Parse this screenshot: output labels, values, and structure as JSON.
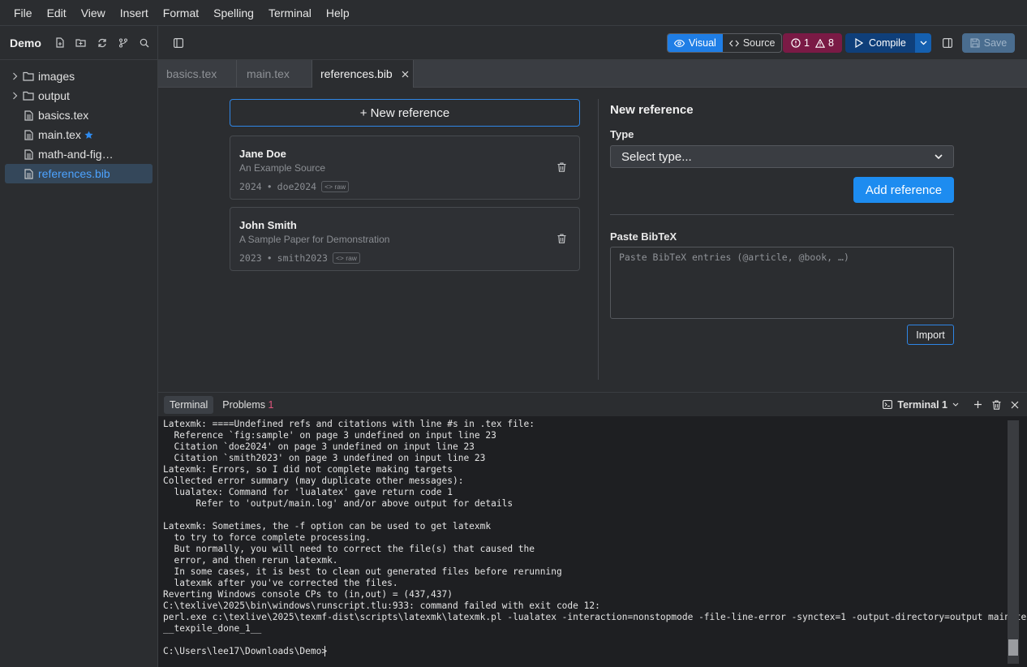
{
  "menu": [
    "File",
    "Edit",
    "View",
    "Insert",
    "Format",
    "Spelling",
    "Terminal",
    "Help"
  ],
  "sidebar": {
    "project_name": "Demo",
    "items": [
      {
        "label": "images",
        "type": "folder"
      },
      {
        "label": "output",
        "type": "folder"
      },
      {
        "label": "basics.tex",
        "type": "file"
      },
      {
        "label": "main.tex",
        "type": "file",
        "starred": true
      },
      {
        "label": "math-and-fig…",
        "type": "file"
      },
      {
        "label": "references.bib",
        "type": "file",
        "active": true
      }
    ]
  },
  "toolbar": {
    "visual_label": "Visual",
    "source_label": "Source",
    "errors_count": "1",
    "warnings_count": "8",
    "compile_label": "Compile",
    "save_label": "Save"
  },
  "tabs": [
    "basics.tex",
    "main.tex",
    "references.bib"
  ],
  "references": {
    "new_button": "+ New reference",
    "entries": [
      {
        "author": "Jane Doe",
        "title": "An Example Source",
        "year": "2024",
        "key": "doe2024",
        "raw": "raw"
      },
      {
        "author": "John Smith",
        "title": "A Sample Paper for Demonstration",
        "year": "2023",
        "key": "smith2023",
        "raw": "raw"
      }
    ]
  },
  "form": {
    "heading": "New reference",
    "type_label": "Type",
    "type_value": "Select type...",
    "add_button": "Add reference",
    "paste_label": "Paste BibTeX",
    "paste_placeholder": "Paste BibTeX entries (@article, @book, …)",
    "import_button": "Import"
  },
  "terminal": {
    "tab_terminal": "Terminal",
    "tab_problems": "Problems",
    "problems_count": "1",
    "terminal_name": "Terminal 1",
    "output": "Latexmk: ====Undefined refs and citations with line #s in .tex file:\n  Reference `fig:sample' on page 3 undefined on input line 23\n  Citation `doe2024' on page 3 undefined on input line 23\n  Citation `smith2023' on page 3 undefined on input line 23\nLatexmk: Errors, so I did not complete making targets\nCollected error summary (may duplicate other messages):\n  lualatex: Command for 'lualatex' gave return code 1\n      Refer to 'output/main.log' and/or above output for details\n\nLatexmk: Sometimes, the -f option can be used to get latexmk\n  to try to force complete processing.\n  But normally, you will need to correct the file(s) that caused the\n  error, and then rerun latexmk.\n  In some cases, it is best to clean out generated files before rerunning\n  latexmk after you've corrected the files.\nReverting Windows console CPs to (in,out) = (437,437)\nC:\\texlive\\2025\\bin\\windows\\runscript.tlu:933: command failed with exit code 12:\nperl.exe c:\\texlive\\2025\\texmf-dist\\scripts\\latexmk\\latexmk.pl -lualatex -interaction=nonstopmode -file-line-error -synctex=1 -output-directory=output main.tex\n__texpile_done_1__\n\nC:\\Users\\lee17\\Downloads\\Demo>"
  }
}
